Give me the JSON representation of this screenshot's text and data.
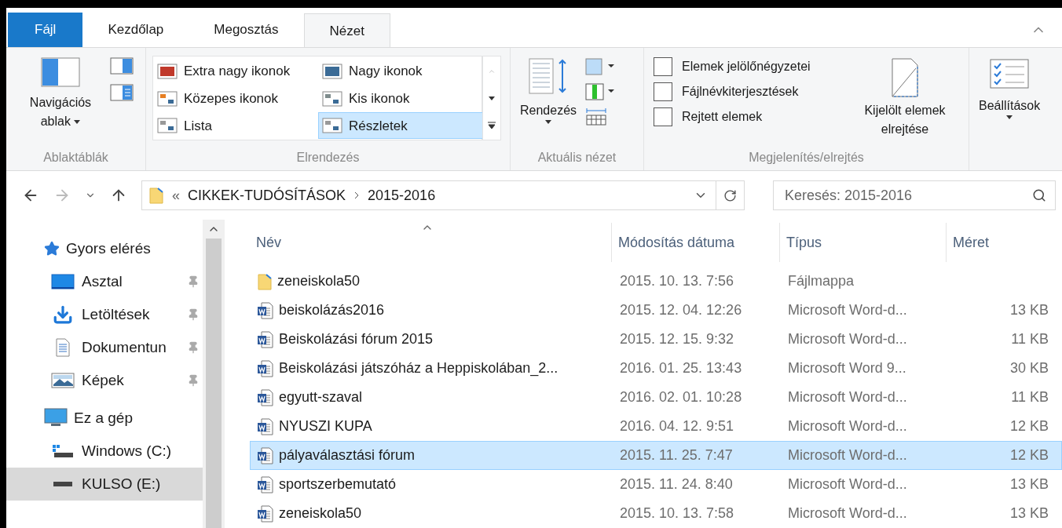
{
  "ribbon_tabs": [
    {
      "label": "Fájl",
      "kind": "file",
      "selected": false
    },
    {
      "label": "Kezdőlap",
      "kind": "tab",
      "selected": false
    },
    {
      "label": "Megosztás",
      "kind": "tab",
      "selected": false
    },
    {
      "label": "Nézet",
      "kind": "tab",
      "selected": true
    }
  ],
  "ribbon": {
    "panes": {
      "button": "Navigációs ablak",
      "group": "Ablaktáblák"
    },
    "layout": {
      "group": "Elrendezés",
      "options": [
        {
          "label": "Extra nagy ikonok",
          "selected": false
        },
        {
          "label": "Nagy ikonok",
          "selected": false
        },
        {
          "label": "Közepes ikonok",
          "selected": false
        },
        {
          "label": "Kis ikonok",
          "selected": false
        },
        {
          "label": "Lista",
          "selected": false
        },
        {
          "label": "Részletek",
          "selected": true
        }
      ]
    },
    "current_view": {
      "button": "Rendezés",
      "group": "Aktuális nézet"
    },
    "show_hide": {
      "group": "Megjelenítés/elrejtés",
      "checkboxes": [
        {
          "label": "Elemek jelölőnégyzetei",
          "checked": false
        },
        {
          "label": "Fájlnévkiterjesztések",
          "checked": false
        },
        {
          "label": "Rejtett elemek",
          "checked": false
        }
      ],
      "hide_button": "Kijelölt elemek elrejtése"
    },
    "options": {
      "button": "Beállítások"
    }
  },
  "address": {
    "overflow": "«",
    "segments": [
      "CIKKEK-TUDÓSÍTÁSOK",
      "2015-2016"
    ]
  },
  "search": {
    "placeholder": "Keresés: 2015-2016"
  },
  "sidebar": {
    "items": [
      {
        "label": "Gyors elérés",
        "kind": "star",
        "selected": false,
        "children": [
          {
            "label": "Asztal",
            "kind": "desktop",
            "pinned": true,
            "selected": false
          },
          {
            "label": "Letöltések",
            "kind": "download",
            "pinned": true,
            "selected": false
          },
          {
            "label": "Dokumentun",
            "kind": "document",
            "pinned": true,
            "selected": false
          },
          {
            "label": "Képek",
            "kind": "pictures",
            "pinned": true,
            "selected": false
          }
        ]
      },
      {
        "label": "Ez a gép",
        "kind": "pc",
        "selected": false,
        "children": [
          {
            "label": "Windows (C:)",
            "kind": "windrive",
            "pinned": false,
            "selected": false
          },
          {
            "label": "KULSO (E:)",
            "kind": "drive",
            "pinned": false,
            "selected": true
          }
        ]
      }
    ]
  },
  "table": {
    "columns": [
      "Név",
      "Módosítás dátuma",
      "Típus",
      "Méret"
    ],
    "rows": [
      {
        "kind": "folder",
        "name": "zeneiskola50",
        "date": "2015. 10. 13. 7:56",
        "type": "Fájlmappa",
        "selected": false
      },
      {
        "kind": "word",
        "name": "beiskolázás2016",
        "date": "2015. 12. 04. 12:26",
        "type": "Microsoft Word-d...",
        "size": "13 KB",
        "selected": false
      },
      {
        "kind": "word",
        "name": "Beiskolázási fórum 2015",
        "date": "2015. 12. 15. 9:32",
        "type": "Microsoft Word-d...",
        "size": "11 KB",
        "selected": false
      },
      {
        "kind": "word97",
        "name": "Beiskolázási játszóház a Heppiskolában_2...",
        "date": "2016. 01. 25. 13:43",
        "type": "Microsoft Word 9...",
        "size": "30 KB",
        "selected": false
      },
      {
        "kind": "word",
        "name": "egyutt-szaval",
        "date": "2016. 02. 01. 10:28",
        "type": "Microsoft Word-d...",
        "size": "11 KB",
        "selected": false
      },
      {
        "kind": "word",
        "name": "NYUSZI KUPA",
        "date": "2016. 04. 12. 9:51",
        "type": "Microsoft Word-d...",
        "size": "12 KB",
        "selected": false
      },
      {
        "kind": "word",
        "name": "pályaválasztási fórum",
        "date": "2015. 11. 25. 7:47",
        "type": "Microsoft Word-d...",
        "size": "12 KB",
        "selected": true
      },
      {
        "kind": "word",
        "name": "sportszerbemutató",
        "date": "2015. 11. 24. 8:40",
        "type": "Microsoft Word-d...",
        "size": "13 KB",
        "selected": false
      },
      {
        "kind": "word",
        "name": "zeneiskola50",
        "date": "2015. 10. 13. 7:58",
        "type": "Microsoft Word-d...",
        "size": "13 KB",
        "selected": false
      }
    ]
  }
}
